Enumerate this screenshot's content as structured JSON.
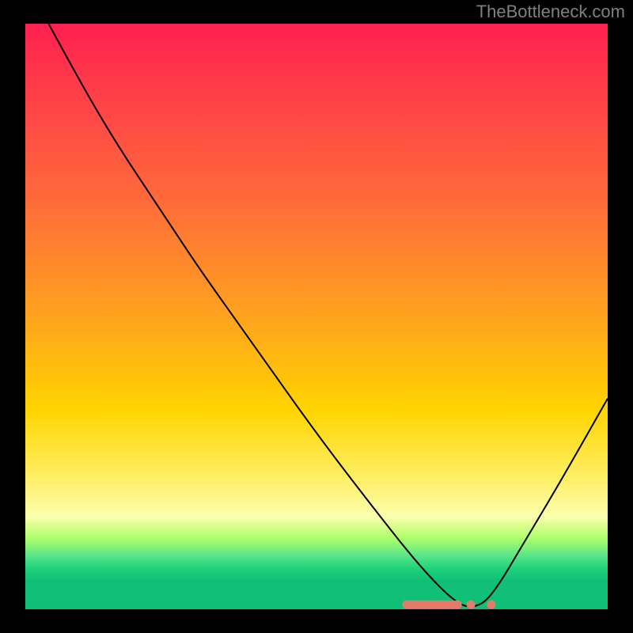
{
  "watermark": "TheBottleneck.com",
  "chart_data": {
    "type": "line",
    "title": "",
    "xlabel": "",
    "ylabel": "",
    "xlim": [
      0,
      100
    ],
    "ylim": [
      0,
      100
    ],
    "grid": false,
    "legend": false,
    "background_gradient": [
      "#ff1f4f",
      "#ff6a3a",
      "#ffa31e",
      "#ffd400",
      "#fff06a",
      "#fbffb0",
      "#a8ff6a",
      "#1fd27a"
    ],
    "curve": {
      "name": "bottleneck-curve",
      "color": "#000000",
      "points": [
        {
          "x": 4,
          "y": 100
        },
        {
          "x": 10,
          "y": 89
        },
        {
          "x": 16,
          "y": 79
        },
        {
          "x": 22,
          "y": 70
        },
        {
          "x": 26,
          "y": 64
        },
        {
          "x": 30,
          "y": 58
        },
        {
          "x": 40,
          "y": 44
        },
        {
          "x": 50,
          "y": 30
        },
        {
          "x": 60,
          "y": 17
        },
        {
          "x": 68,
          "y": 7
        },
        {
          "x": 74,
          "y": 1
        },
        {
          "x": 77,
          "y": 0.2
        },
        {
          "x": 80,
          "y": 2
        },
        {
          "x": 86,
          "y": 12
        },
        {
          "x": 92,
          "y": 22
        },
        {
          "x": 100,
          "y": 36
        }
      ]
    },
    "markers": {
      "name": "marker-cluster",
      "color": "#e47a6a",
      "points": [
        {
          "x": 65.5,
          "y": 0.8
        },
        {
          "x": 66.2,
          "y": 0.8
        },
        {
          "x": 67.0,
          "y": 0.8
        },
        {
          "x": 67.8,
          "y": 0.8
        },
        {
          "x": 68.6,
          "y": 0.8
        },
        {
          "x": 69.4,
          "y": 0.8
        },
        {
          "x": 70.2,
          "y": 0.8
        },
        {
          "x": 71.0,
          "y": 0.8
        },
        {
          "x": 71.8,
          "y": 0.8
        },
        {
          "x": 72.6,
          "y": 0.8
        },
        {
          "x": 73.4,
          "y": 0.8
        },
        {
          "x": 74.2,
          "y": 0.8
        },
        {
          "x": 76.5,
          "y": 0.8
        },
        {
          "x": 80.0,
          "y": 0.8
        }
      ]
    }
  }
}
